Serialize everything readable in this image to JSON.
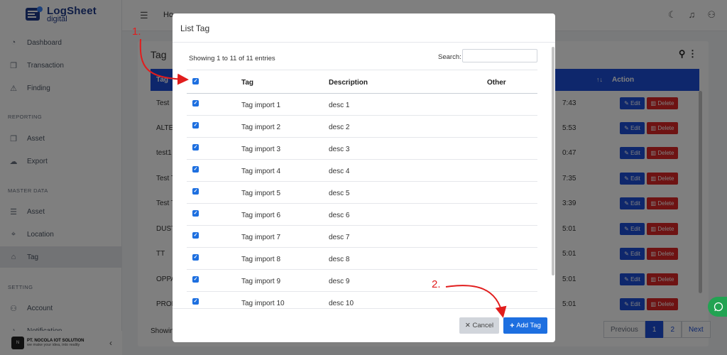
{
  "app": {
    "logo_name": "LogSheet",
    "logo_sub": "digital"
  },
  "sidebar": {
    "items": [
      {
        "label": "Dashboard",
        "icon": "gauge-icon"
      },
      {
        "label": "Transaction",
        "icon": "copy-icon"
      },
      {
        "label": "Finding",
        "icon": "warning-icon"
      },
      {
        "label": "Asset",
        "icon": "copy-icon"
      },
      {
        "label": "Export",
        "icon": "cloud-download-icon"
      },
      {
        "label": "Asset",
        "icon": "list-icon"
      },
      {
        "label": "Location",
        "icon": "map-pin-icon"
      },
      {
        "label": "Tag",
        "icon": "tag-icon"
      },
      {
        "label": "Account",
        "icon": "user-icon"
      },
      {
        "label": "Notification",
        "icon": "bell-icon"
      }
    ],
    "sections": [
      "REPORTING",
      "MASTER DATA",
      "SETTING"
    ],
    "active": "Tag",
    "footer": {
      "company_name": "PT. NOCOLA IOT SOLUTION",
      "company_tagline": "we make your idea, into reality"
    }
  },
  "header": {
    "breadcrumb": "Ho",
    "icons": [
      "moon-icon",
      "bell-icon",
      "user-icon"
    ]
  },
  "page": {
    "title": "Tag",
    "table": {
      "col_tag": "Tag",
      "col_action": "Action",
      "rows": [
        {
          "tag": "Test",
          "time": "7:43"
        },
        {
          "tag": "ALTER",
          "time": "5:53"
        },
        {
          "tag": "test1",
          "time": "0:47"
        },
        {
          "tag": "Test T",
          "time": "7:35"
        },
        {
          "tag": "Test T",
          "time": "3:39"
        },
        {
          "tag": "DUST",
          "time": "5:01"
        },
        {
          "tag": "TT",
          "time": "5:01"
        },
        {
          "tag": "OPPA",
          "time": "5:01"
        },
        {
          "tag": "PROB",
          "time": "5:01"
        }
      ],
      "edit_label": "Edit",
      "delete_label": "Delete"
    },
    "showing": "Showin",
    "pagination": {
      "prev": "Previous",
      "pages": [
        "1",
        "2"
      ],
      "next": "Next",
      "active": "1"
    }
  },
  "modal": {
    "title": "List Tag",
    "entries_info": "Showing 1 to 11 of 11 entries",
    "search_label": "Search:",
    "search_value": "",
    "columns": {
      "tag": "Tag",
      "description": "Description",
      "other": "Other"
    },
    "rows": [
      {
        "tag": "Tag import 1",
        "description": "desc 1",
        "checked": true
      },
      {
        "tag": "Tag import 2",
        "description": "desc 2",
        "checked": true
      },
      {
        "tag": "Tag import 3",
        "description": "desc 3",
        "checked": true
      },
      {
        "tag": "Tag import 4",
        "description": "desc 4",
        "checked": true
      },
      {
        "tag": "Tag import 5",
        "description": "desc 5",
        "checked": true
      },
      {
        "tag": "Tag import 6",
        "description": "desc 6",
        "checked": true
      },
      {
        "tag": "Tag import 7",
        "description": "desc 7",
        "checked": true
      },
      {
        "tag": "Tag import 8",
        "description": "desc 8",
        "checked": true
      },
      {
        "tag": "Tag import 9",
        "description": "desc 9",
        "checked": true
      },
      {
        "tag": "Tag import 10",
        "description": "desc 10",
        "checked": true
      }
    ],
    "cancel_label": "Cancel",
    "add_label": "Add Tag"
  },
  "annotations": {
    "step1": "1.",
    "step2": "2."
  },
  "colors": {
    "primary": "#1d4ed8",
    "danger": "#dc2626",
    "annotation": "#e11d1d",
    "whatsapp": "#22a352"
  }
}
